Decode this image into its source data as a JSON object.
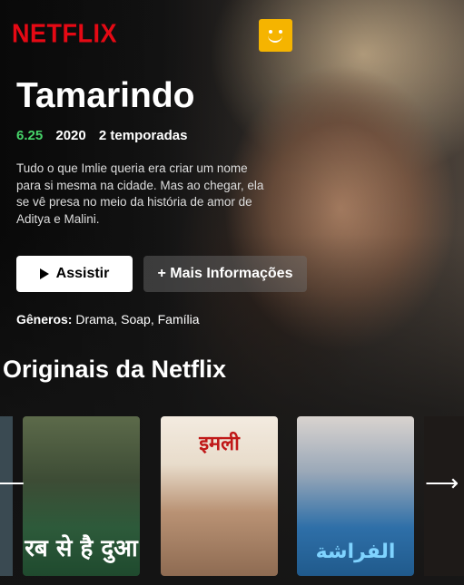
{
  "header": {
    "logo": "NETFLIX",
    "avatar_icon": "smiley-face-icon"
  },
  "hero": {
    "title": "Tamarindo",
    "rating": "6.25",
    "year": "2020",
    "seasons": "2 temporadas",
    "description": "Tudo o que Imlie queria era criar um nome para si mesma na cidade. Mas ao chegar, ela se vê presa no meio da história de amor de Aditya e Malini.",
    "play_label": "Assistir",
    "info_label": "+ Mais Informações",
    "genres_label": "Gêneros:",
    "genres_value": "Drama, Soap, Família"
  },
  "row": {
    "title": "Originais da Netflix",
    "prev_arrow": "⟵",
    "next_arrow": "⟶",
    "cards": [
      {
        "caption": "रब से है दुआ"
      },
      {
        "caption": "इमली"
      },
      {
        "caption": "الفراشة"
      }
    ]
  },
  "colors": {
    "brand": "#e50914",
    "rating": "#46d369",
    "avatar": "#f5b400"
  }
}
